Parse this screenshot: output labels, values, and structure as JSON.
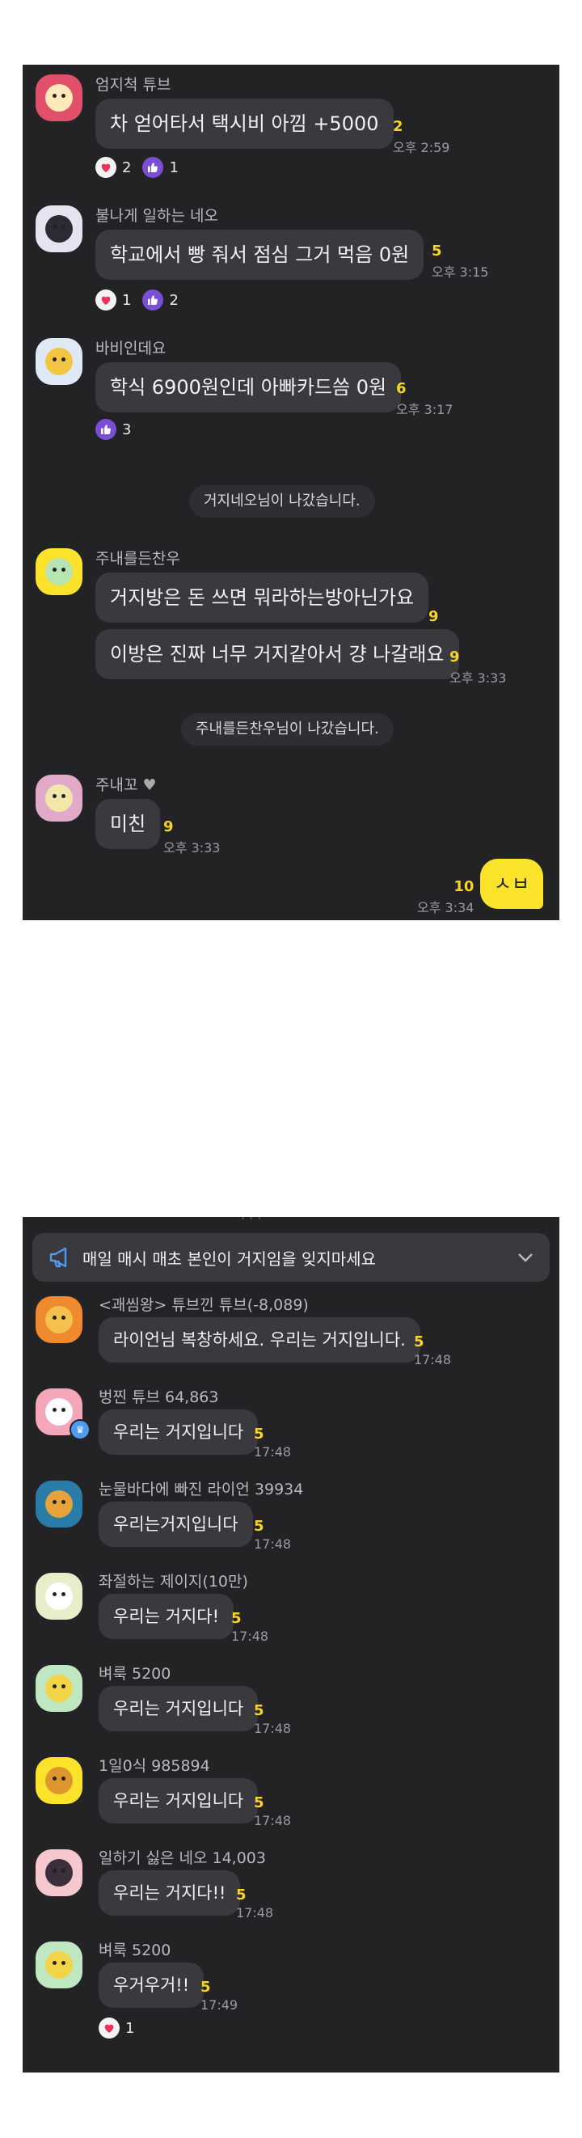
{
  "panel1": {
    "messages": [
      {
        "name": "엄지척 튜브",
        "text": "차 얻어타서 택시비 아낌 +5000",
        "count": "2",
        "time": "오후 2:59",
        "reactions": {
          "heart": "2",
          "thumb": "1"
        }
      },
      {
        "name": "불나게 일하는 네오",
        "text": "학교에서 빵 줘서 점심 그거 먹음 0원",
        "count": "5",
        "time": "오후 3:15",
        "reactions": {
          "heart": "1",
          "thumb": "2"
        }
      },
      {
        "name": "바비인데요",
        "text": "학식 6900원인데 아빠카드씀 0원",
        "count": "6",
        "time": "오후 3:17",
        "reactions": {
          "thumb": "3"
        }
      },
      {
        "name": "주내를든찬우",
        "text1": "거지방은 돈 쓰면 뭐라하는방아닌가요",
        "count1": "9",
        "text2": "이방은 진짜 너무 거지같아서 걍 나갈래요",
        "count2": "9",
        "time": "오후 3:33"
      },
      {
        "name": "주내꼬",
        "text": "미친",
        "count": "9",
        "time": "오후 3:33"
      }
    ],
    "notices": [
      "거지네오님이 나갔습니다.",
      "주내를든찬우님이 나갔습니다."
    ],
    "mine": {
      "text": "ㅅㅂ",
      "count": "10",
      "time": "오후 3:34"
    }
  },
  "panel2": {
    "banner": "매일 매시 매초 본인이 거지임을 잊지마세요",
    "messages": [
      {
        "name": "<괘씸왕> 튜브낀 튜브(-8,089)",
        "text": "라이언님 복창하세요. 우리는 거지입니다.",
        "count": "5",
        "time": "17:48"
      },
      {
        "name": "벙찐 튜브 64,863",
        "text": "우리는 거지입니다",
        "count": "5",
        "time": "17:48"
      },
      {
        "name": "눈물바다에 빠진 라이언 39934",
        "text": "우리는거지입니다",
        "count": "5",
        "time": "17:48"
      },
      {
        "name": "좌절하는 제이지(10만)",
        "text": "우리는 거지다!",
        "count": "5",
        "time": "17:48"
      },
      {
        "name": "벼룩 5200",
        "text": "우리는 거지입니다",
        "count": "5",
        "time": "17:48"
      },
      {
        "name": "1일0식 985894",
        "text": "우리는 거지입니다",
        "count": "5",
        "time": "17:48"
      },
      {
        "name": "일하기 싫은 네오 14,003",
        "text": "우리는 거지다!!",
        "count": "5",
        "time": "17:48"
      },
      {
        "name": "벼룩 5200",
        "text": "우거우거!!",
        "count": "5",
        "time": "17:49",
        "reactions": {
          "heart": "1"
        }
      }
    ]
  },
  "icons": [
    "heart-icon",
    "thumbs-up-icon",
    "megaphone-icon",
    "chevron-down-icon"
  ],
  "colors": {
    "background": "#232326",
    "bubble": "#3a3a3e",
    "mine_bubble": "#fbe32c",
    "count": "#f7d32a",
    "thumb_react": "#7a4fd6"
  }
}
